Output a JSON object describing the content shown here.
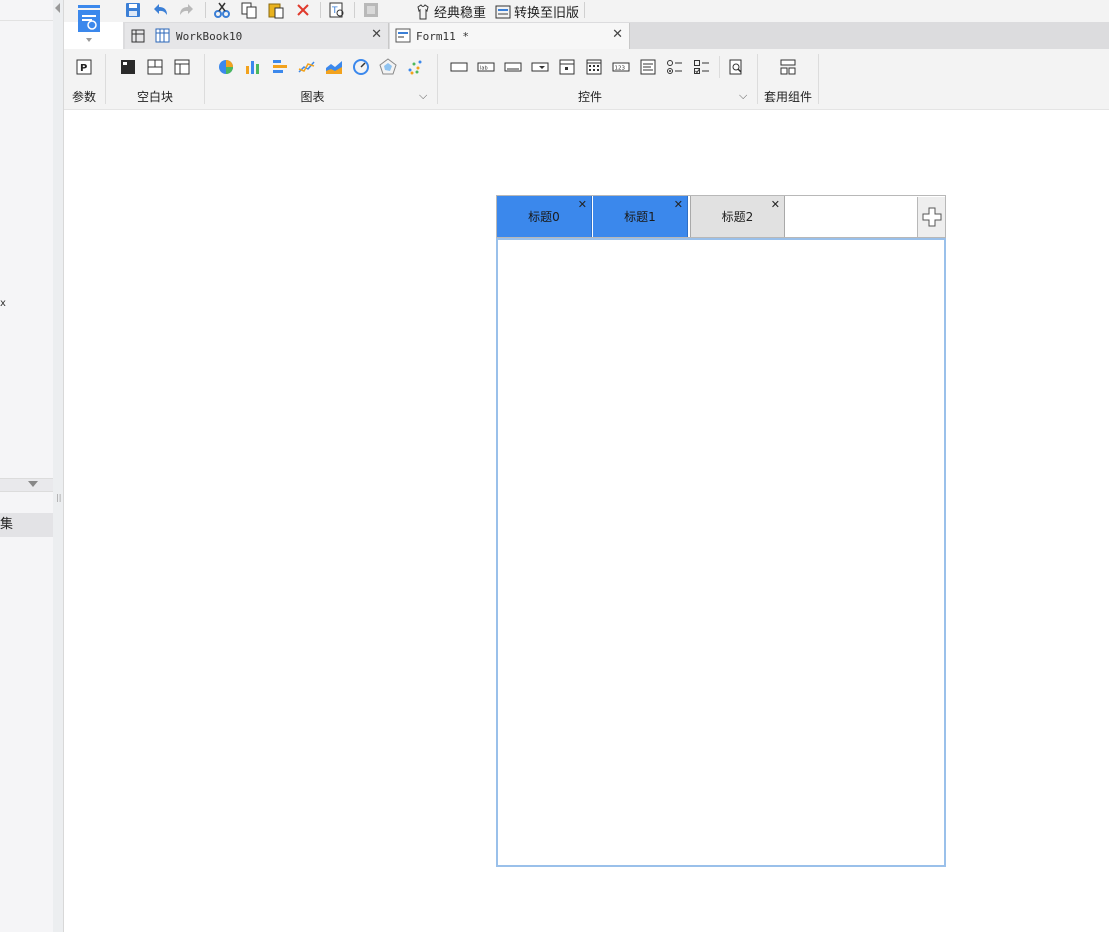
{
  "left_panel": {
    "stray_char": "x",
    "item_label": "集"
  },
  "quickbar": {
    "save_icon": "save-icon",
    "undo_icon": "undo-icon",
    "redo_icon": "redo-icon",
    "cut_icon": "cut-icon",
    "copy_icon": "copy-icon",
    "paste_icon": "paste-icon",
    "delete_icon": "delete-icon",
    "preview_icon": "text-preview-icon",
    "classic_label": "经典稳重",
    "convert_label": "转换至旧版"
  },
  "tabs": [
    {
      "label": "WorkBook10",
      "close": "✕"
    },
    {
      "label": "Form11 *",
      "close": "✕"
    }
  ],
  "ribbon": {
    "groups": {
      "params": "参数",
      "blank": "空白块",
      "chart": "图表",
      "controls": "控件",
      "templates": "套用组件"
    }
  },
  "tab_widget": {
    "tabs": [
      {
        "label": "标题0",
        "close": "✕",
        "state": "active"
      },
      {
        "label": "标题1",
        "close": "✕",
        "state": "active"
      },
      {
        "label": "标题2",
        "close": "✕",
        "state": "inactive"
      }
    ],
    "add_icon": "plus-icon",
    "colors": {
      "active_tab": "#3b88ec",
      "body_border": "#9ac0ea"
    }
  }
}
